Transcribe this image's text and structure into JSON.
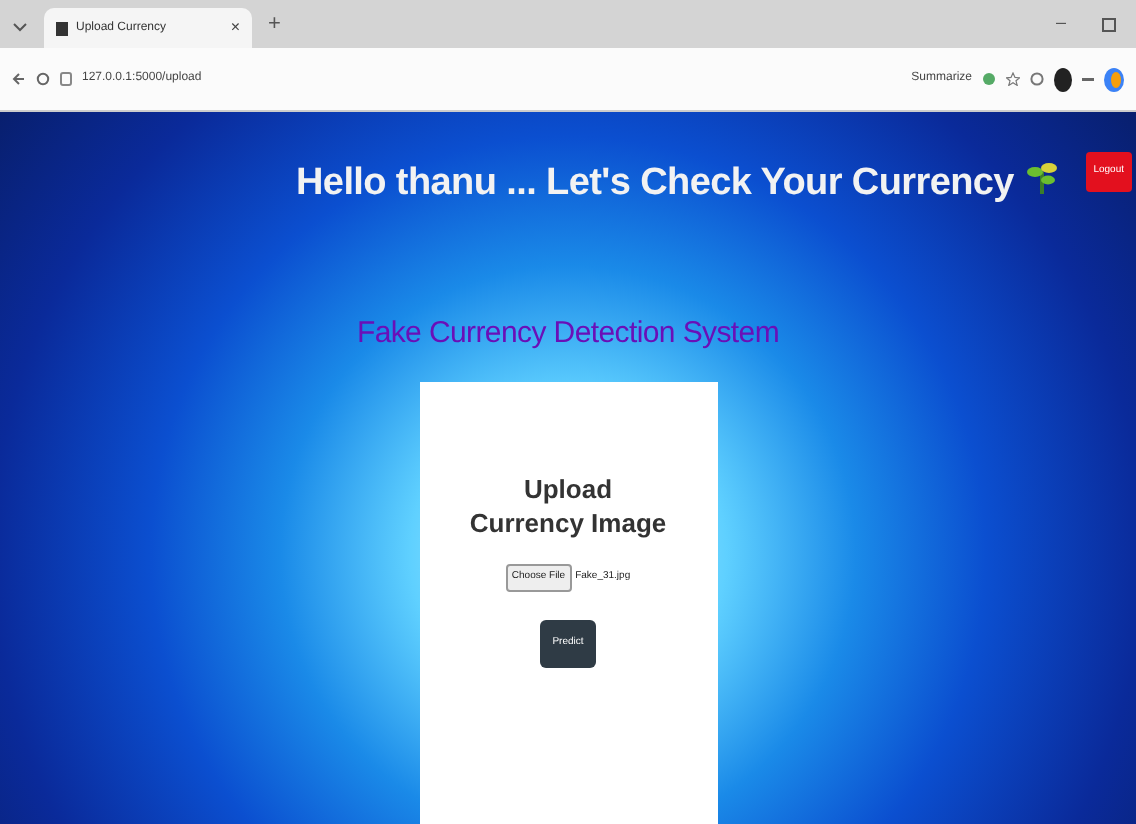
{
  "browser": {
    "tab_title": "Upload Currency",
    "tab_close": "×",
    "new_tab": "+",
    "url": "127.0.0.1:5000/upload",
    "summarize": "Summarize",
    "minimize": "–"
  },
  "header": {
    "greeting": "Hello thanu ... Let's Check Your Currency",
    "logout": "Logout"
  },
  "subtitle": "Fake Currency Detection System",
  "card": {
    "title": "Upload Currency Image",
    "choose_file": "Choose File",
    "file_name": "Fake_31.jpg",
    "predict": "Predict"
  }
}
